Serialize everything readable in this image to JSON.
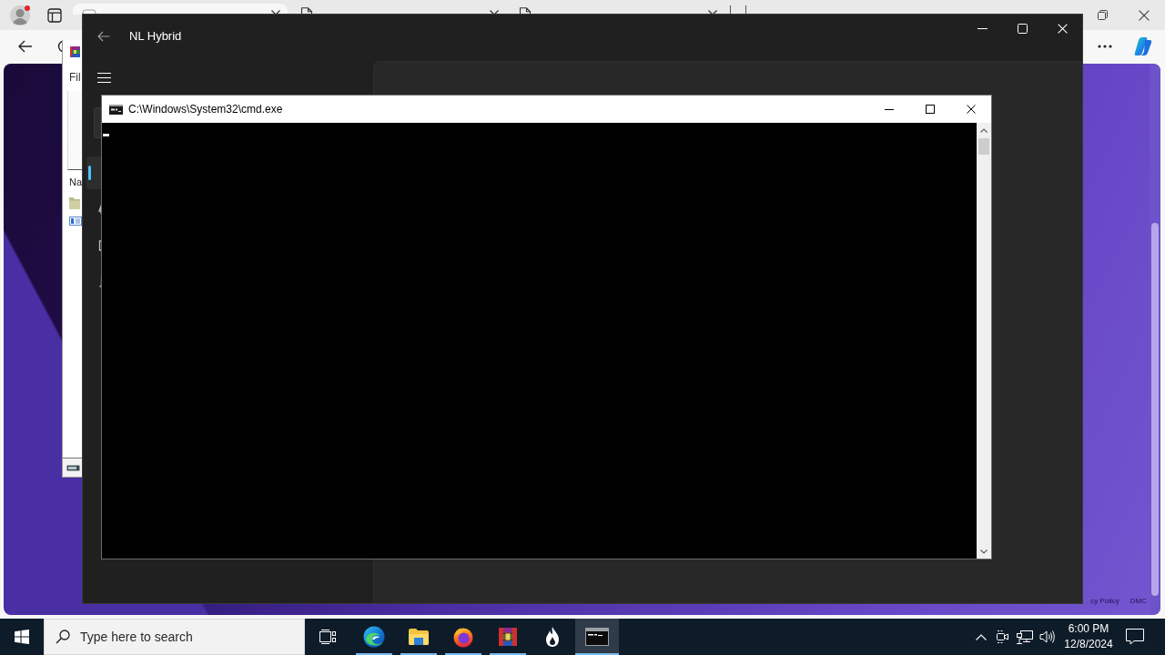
{
  "browser": {
    "tabs": [
      {
        "kind": "site",
        "selected": true
      },
      {
        "kind": "page",
        "selected": false
      },
      {
        "kind": "page",
        "selected": false
      }
    ],
    "page_footer": {
      "links": [
        "cy Policy",
        "DMC"
      ]
    }
  },
  "background_window": {
    "menu": "Fil",
    "column_header": "Na"
  },
  "app_window": {
    "title": "NL Hybrid",
    "nav_items": [
      {
        "selected": true
      },
      {
        "selected": false
      },
      {
        "selected": false
      },
      {
        "selected": false
      }
    ]
  },
  "console_window": {
    "title": "C:\\Windows\\System32\\cmd.exe"
  },
  "taskbar": {
    "search": {
      "placeholder": "Type here to search"
    },
    "apps": [
      {
        "kind": "swirl",
        "running": true,
        "selected": false
      },
      {
        "kind": "folder",
        "running": true,
        "selected": false
      },
      {
        "kind": "orb",
        "running": true,
        "selected": false
      },
      {
        "kind": "books",
        "running": true,
        "selected": false
      },
      {
        "kind": "flame",
        "running": false,
        "selected": false
      },
      {
        "kind": "terminal",
        "running": true,
        "selected": true
      }
    ],
    "clock": {
      "time": "6:00 PM",
      "date": "12/8/2024"
    }
  }
}
